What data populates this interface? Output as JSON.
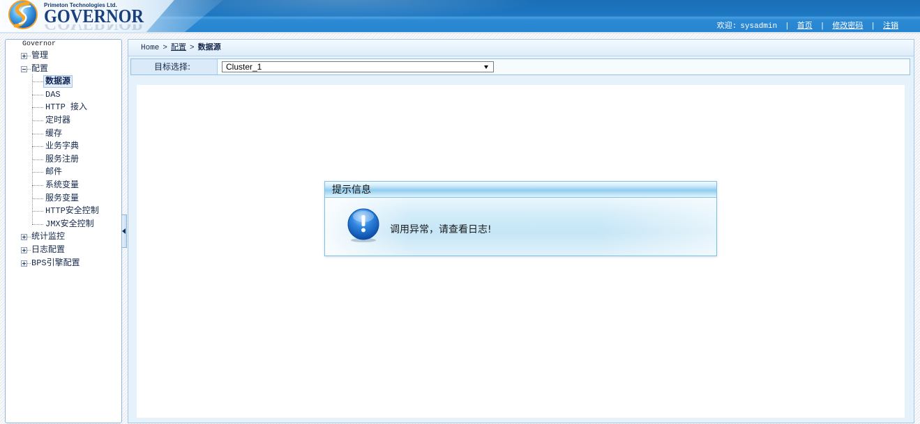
{
  "header": {
    "company": "Primeton Technologies Ltd.",
    "product": "GOVERNOR",
    "logo_icon": "primeton-swirl-logo",
    "welcome_label": "欢迎:",
    "username": "sysadmin",
    "separator": "|",
    "links": [
      "首页",
      "修改密码",
      "注销"
    ]
  },
  "sidebar": {
    "root": "Governor",
    "items": [
      {
        "label": "管理",
        "level": 0,
        "expanded": false
      },
      {
        "label": "配置",
        "level": 0,
        "expanded": true
      },
      {
        "label": "数据源",
        "level": 1,
        "selected": true
      },
      {
        "label": "DAS",
        "level": 1
      },
      {
        "label": "HTTP 接入",
        "level": 1
      },
      {
        "label": "定时器",
        "level": 1
      },
      {
        "label": "缓存",
        "level": 1
      },
      {
        "label": "业务字典",
        "level": 1
      },
      {
        "label": "服务注册",
        "level": 1
      },
      {
        "label": "邮件",
        "level": 1
      },
      {
        "label": "系统变量",
        "level": 1
      },
      {
        "label": "服务变量",
        "level": 1
      },
      {
        "label": "HTTP安全控制",
        "level": 1
      },
      {
        "label": "JMX安全控制",
        "level": 1
      },
      {
        "label": "统计监控",
        "level": 0,
        "expanded": false
      },
      {
        "label": "日志配置",
        "level": 0,
        "expanded": false
      },
      {
        "label": "BPS引擎配置",
        "level": 0,
        "expanded": false
      }
    ]
  },
  "breadcrumb": {
    "items": [
      "Home",
      "配置",
      "数据源"
    ],
    "separator": ">"
  },
  "filter": {
    "label": "目标选择:",
    "selected": "Cluster_1"
  },
  "dialog": {
    "title": "提示信息",
    "message": "调用异常，请查看日志!",
    "icon": "exclamation-icon"
  },
  "colors": {
    "header_blue": "#1e78c3",
    "header_link_text": "#ffffff",
    "panel_border": "#a3c8e8",
    "panel_background": "#e5f2fb",
    "tree_text": "#15294a",
    "selected_item_background": "#e4effb",
    "dialog_border": "#7ec0e6",
    "alert_icon_blue": "#2f86e0"
  }
}
